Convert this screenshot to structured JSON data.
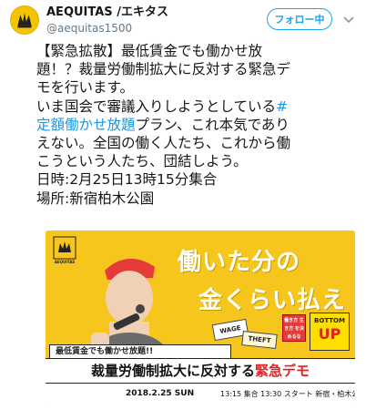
{
  "account": {
    "display_name": "AEQUITAS /エキタス",
    "handle": "@aequitas1500",
    "follow_label": "フォロー中"
  },
  "tweet": {
    "lines": [
      "【緊急拡散】最低賃金でも働かせ放",
      "題！？裁量労働制拡大に反対する緊急デ",
      "モを行います。",
      "いま国会で審議入りしようとしている",
      "プラン、これ本気であり",
      "えない。全国の働く人たち、これから働",
      "こうという人たち、団結しよう。",
      "日時:2月25日13時15分集合",
      "場所:新宿柏木公園"
    ],
    "hashtag_line1": "#",
    "hashtag_line2": "定額働かせ放題"
  },
  "poster": {
    "logo_text": "AEQUITAS",
    "headline_1": "働いた分の",
    "headline_2": "金くらい払え",
    "sign_wage": "WAGE",
    "sign_theft": "THEFT",
    "sign_red": "働き方 生き方 を決めるな",
    "sign_bottom_1": "BOTTOM",
    "sign_bottom_2": "UP",
    "banner_small": "最低賃金でも働かせ放題!!",
    "banner_main_1": "裁量労働制拡大に反対する",
    "banner_main_2": "緊急デモ",
    "banner_date": "2018.2.25 SUN",
    "banner_time": "13:15 集合 13:30 スタート  新宿・柏木公園"
  },
  "colors": {
    "accent": "#1da1f2",
    "hashtag": "#1b95e0",
    "poster_yellow": "#f7c61c",
    "demo_red": "#e32020"
  },
  "icons": [
    "avatar-logo-icon",
    "chevron-down-icon"
  ]
}
